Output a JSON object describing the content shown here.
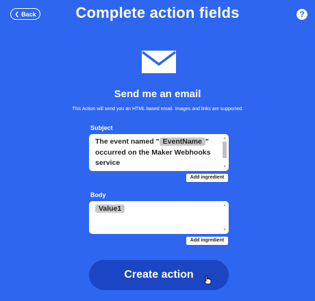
{
  "header": {
    "back_label": "Back",
    "title": "Complete action fields",
    "help_label": "?"
  },
  "service": {
    "icon": "envelope-icon",
    "title": "Send me an email",
    "description": "This Action will send you an HTML based email. Images and links are supported."
  },
  "fields": {
    "subject": {
      "label": "Subject",
      "text_before": "The event named \"",
      "ingredient": "EventName",
      "text_after": "\" occurred on the Maker Webhooks service",
      "add_ingredient_label": "Add ingredient"
    },
    "body": {
      "label": "Body",
      "ingredient": "Value1",
      "add_ingredient_label": "Add ingredient"
    }
  },
  "create_action_label": "Create action",
  "colors": {
    "background": "#2E66F0",
    "button": "#1B45C2",
    "ingredient_pill": "#C8C8C8"
  }
}
